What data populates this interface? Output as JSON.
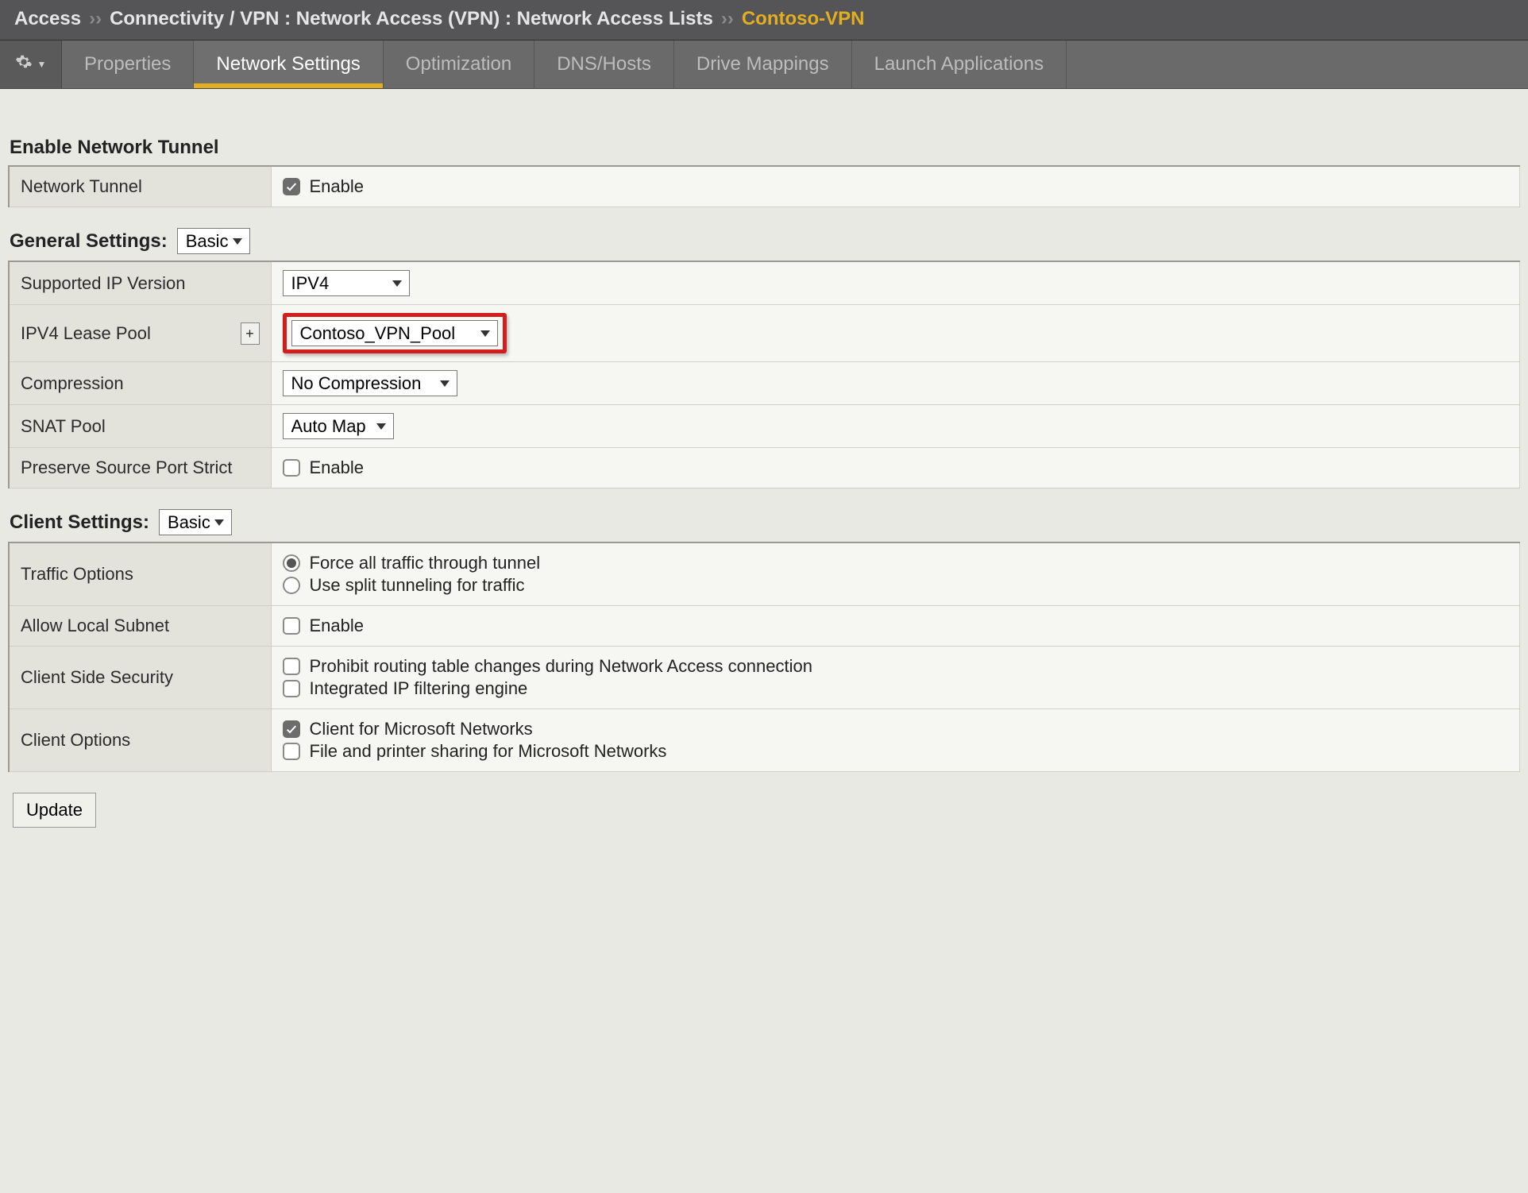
{
  "breadcrumb": {
    "root": "Access",
    "sep": "››",
    "path": "Connectivity / VPN : Network Access (VPN) : Network Access Lists",
    "current": "Contoso-VPN"
  },
  "tabs": [
    {
      "label": "Properties",
      "active": false
    },
    {
      "label": "Network Settings",
      "active": true
    },
    {
      "label": "Optimization",
      "active": false
    },
    {
      "label": "DNS/Hosts",
      "active": false
    },
    {
      "label": "Drive Mappings",
      "active": false
    },
    {
      "label": "Launch Applications",
      "active": false
    }
  ],
  "sections": {
    "tunnel": {
      "title": "Enable Network Tunnel",
      "rows": {
        "network_tunnel": {
          "label": "Network Tunnel",
          "checkbox_label": "Enable",
          "checked": true
        }
      }
    },
    "general": {
      "title": "General Settings:",
      "mode": "Basic",
      "rows": {
        "ip_version": {
          "label": "Supported IP Version",
          "value": "IPV4"
        },
        "lease_pool": {
          "label": "IPV4 Lease Pool",
          "value": "Contoso_VPN_Pool",
          "add_label": "+"
        },
        "compression": {
          "label": "Compression",
          "value": "No Compression"
        },
        "snat": {
          "label": "SNAT Pool",
          "value": "Auto Map"
        },
        "preserve_port": {
          "label": "Preserve Source Port Strict",
          "checkbox_label": "Enable",
          "checked": false
        }
      }
    },
    "client": {
      "title": "Client Settings:",
      "mode": "Basic",
      "rows": {
        "traffic": {
          "label": "Traffic Options",
          "options": [
            {
              "label": "Force all traffic through tunnel",
              "selected": true
            },
            {
              "label": "Use split tunneling for traffic",
              "selected": false
            }
          ]
        },
        "allow_local": {
          "label": "Allow Local Subnet",
          "checkbox_label": "Enable",
          "checked": false
        },
        "security": {
          "label": "Client Side Security",
          "options": [
            {
              "label": "Prohibit routing table changes during Network Access connection",
              "checked": false
            },
            {
              "label": "Integrated IP filtering engine",
              "checked": false
            }
          ]
        },
        "client_opts": {
          "label": "Client Options",
          "options": [
            {
              "label": "Client for Microsoft Networks",
              "checked": true
            },
            {
              "label": "File and printer sharing for Microsoft Networks",
              "checked": false
            }
          ]
        }
      }
    }
  },
  "footer": {
    "update": "Update"
  }
}
